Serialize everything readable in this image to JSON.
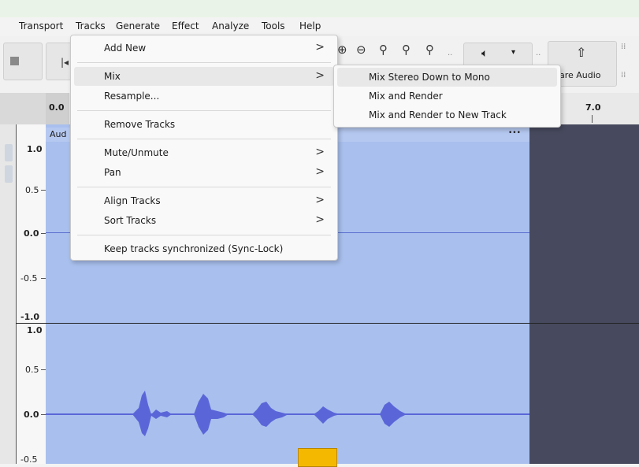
{
  "menubar": {
    "items": [
      "Transport",
      "Tracks",
      "Generate",
      "Effect",
      "Analyze",
      "Tools",
      "Help"
    ]
  },
  "toolbar": {
    "share_label": "hare Audio",
    "volume_icon": "speaker-icon",
    "zoom_icons": [
      "zoom-in-icon",
      "zoom-out-icon",
      "fit-selection-icon",
      "fit-project-icon",
      "zoom-toggle-icon"
    ]
  },
  "ruler": {
    "start": "0.0",
    "label_7": "7.0"
  },
  "track": {
    "name": "Aud",
    "menu_dots": "•••",
    "scale_top": [
      "1.0",
      "0.5",
      "0.0",
      "-0.5",
      "-1.0"
    ],
    "scale_bottom": [
      "1.0",
      "0.5",
      "0.0",
      "-0.5"
    ]
  },
  "tracks_menu": {
    "items": [
      {
        "label": "Add New",
        "submenu": true
      },
      {
        "label": "Mix",
        "submenu": true
      },
      {
        "label": "Resample...",
        "submenu": false
      },
      {
        "label": "Remove Tracks",
        "submenu": false
      },
      {
        "label": "Mute/Unmute",
        "submenu": true
      },
      {
        "label": "Pan",
        "submenu": true
      },
      {
        "label": "Align Tracks",
        "submenu": true
      },
      {
        "label": "Sort Tracks",
        "submenu": true
      },
      {
        "label": "Keep tracks synchronized (Sync-Lock)",
        "submenu": false
      }
    ],
    "arrow": ">"
  },
  "mix_submenu": {
    "items": [
      "Mix Stereo Down to Mono",
      "Mix and Render",
      "Mix and Render to New Track"
    ]
  },
  "colors": {
    "wave_bg": "#a9c0ee",
    "wave": "#5a66d8",
    "dark": "#474a5e",
    "highlight": "#e8e8e8",
    "cursor_box": "#f5b800"
  }
}
